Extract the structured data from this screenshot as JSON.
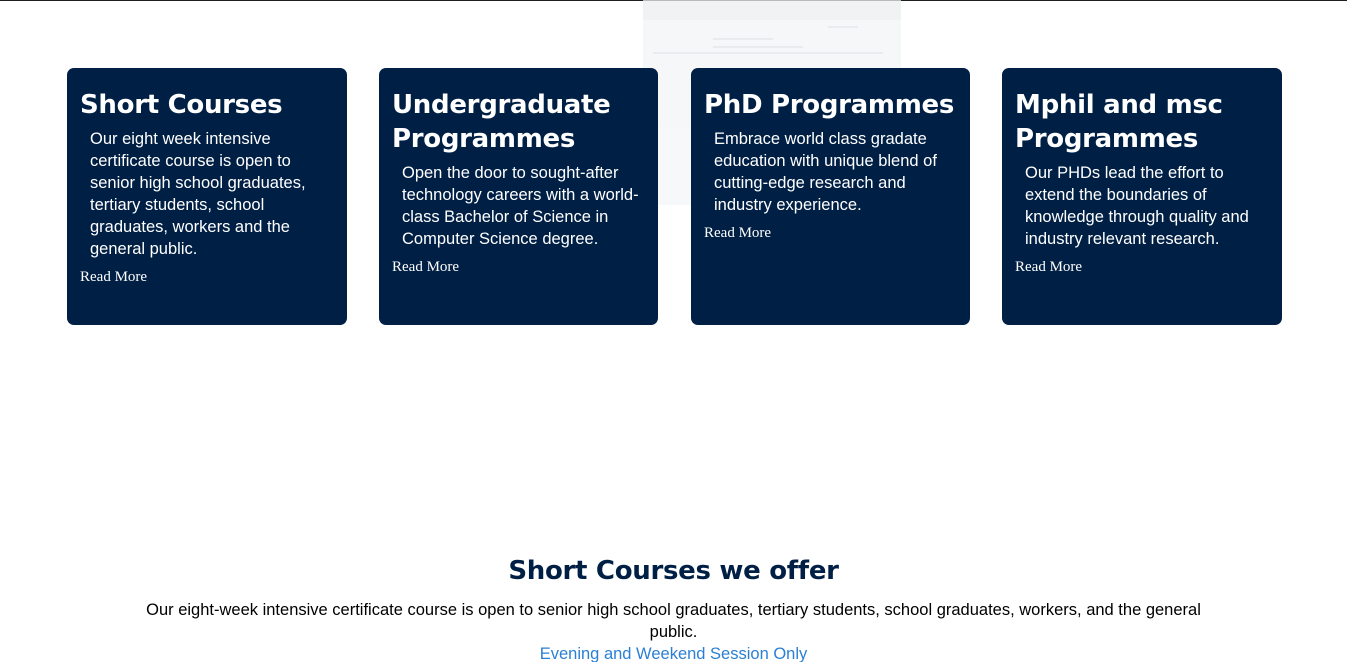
{
  "cards": [
    {
      "title": "Short Courses",
      "description": "Our eight week intensive certificate course is open to senior high school graduates, tertiary students, school graduates, workers and the general public.",
      "link": "Read More"
    },
    {
      "title": "Undergraduate Programmes",
      "description": "Open the door to sought-after technology careers with a world-class Bachelor of Science in Computer Science degree.",
      "link": "Read More"
    },
    {
      "title": "PhD Programmes",
      "description": "Embrace world class gradate education with unique blend of cutting-edge research and industry experience.",
      "link": "Read More"
    },
    {
      "title": "Mphil and msc Programmes",
      "description": "Our PHDs lead the effort to extend the boundaries of knowledge through quality and industry relevant research.",
      "link": "Read More"
    }
  ],
  "short_courses_section": {
    "title": "Short Courses we offer",
    "description": "Our eight-week intensive certificate course is open to senior high school graduates, tertiary students, school graduates, workers, and the general public.",
    "session_link": "Evening and Weekend Session Only"
  },
  "colors": {
    "card_background": "#001f45",
    "heading": "#001f45",
    "link": "#2b7fd4"
  }
}
